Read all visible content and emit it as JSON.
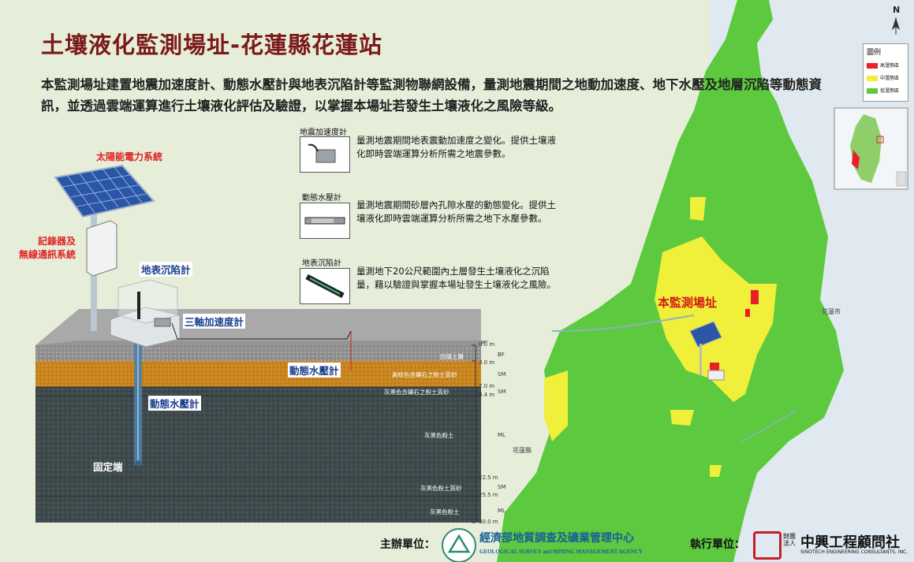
{
  "title": "土壤液化監測場址-花蓮縣花蓮站",
  "description": "本監測場址建置地震加速度計、動態水壓計與地表沉陷計等監測物聯網設備，量測地震期間之地動加速度、地下水壓及地層沉陷等動態資訊，並透過雲端運算進行土壤液化評估及驗證，以掌握本場址若發生土壤液化之風險等級。",
  "instruments": [
    {
      "label": "地震加速度計",
      "desc": "量測地震期間地表震動加速度之變化。提供土壤液化即時雲端運算分析所需之地震參數。",
      "icon": "accelerometer-icon"
    },
    {
      "label": "動態水壓計",
      "desc": "量測地震期間砂層內孔隙水壓的動態變化。提供土壤液化即時雲端運算分析所需之地下水壓參數。",
      "icon": "piezometer-icon"
    },
    {
      "label": "地表沉陷計",
      "desc": "量測地下20公尺範圍內土層發生土壤液化之沉陷量，藉以驗證與掌握本場址發生土壤液化之風險。",
      "icon": "settlement-gauge-icon"
    }
  ],
  "diagram_labels": {
    "solar": "太陽能電力系統",
    "recorder_line1": "記錄器及",
    "recorder_line2": "無線通訊系統",
    "settlement": "地表沉陷計",
    "accelerometer": "三軸加速度計",
    "piezometer_upper": "動態水壓計",
    "piezometer_lower": "動態水壓計",
    "anchor": "固定端"
  },
  "soil_layers": [
    {
      "name": "回填土層",
      "code": "BF",
      "top": "0.0 m",
      "color": "#8e8e8e"
    },
    {
      "name": "黃棕色含礫石之粉土質砂",
      "code": "SM",
      "top": "3.0 m",
      "color": "#c9851f"
    },
    {
      "name": "灰黑色含礫石之粉土質砂",
      "code": "SM",
      "top": "7.0 m",
      "color": "#3e4a4c"
    },
    {
      "name": "灰黑色粉土",
      "code": "ML",
      "top": "8.4 m",
      "color": "#3e4a4c"
    },
    {
      "name": "灰黑色粉土質砂",
      "code": "SM",
      "top": "22.5 m",
      "color": "#3e4a4c"
    },
    {
      "name": "灰黑色粉土",
      "code": "ML",
      "top": "25.5 m",
      "color": "#3e4a4c"
    }
  ],
  "bottom_depth": "30.0 m",
  "map": {
    "site_label": "本監測場址",
    "county_label": "花蓮縣",
    "town_label": "花蓮市",
    "north": "N",
    "colors": {
      "high": "#e8202a",
      "medium": "#f0ef3a",
      "low": "#5cc93f",
      "sea": "#dfe9ef"
    }
  },
  "legend": {
    "title": "圖例",
    "items": [
      {
        "label": "高潛勢區",
        "color": "#e8202a"
      },
      {
        "label": "中潛勢區",
        "color": "#f0ef3a"
      },
      {
        "label": "低潛勢區",
        "color": "#5cc93f"
      }
    ]
  },
  "footer": {
    "organizer_label": "主辦單位：",
    "organizer_name": "經濟部地質調查及礦業管理中心",
    "organizer_name_en": "GEOLOGICAL SURVEY and MINING MANAGEMENT AGENCY",
    "executor_label": "執行單位：",
    "executor_prefix_1": "財團",
    "executor_prefix_2": "法人",
    "executor_name": "中興工程顧問社",
    "executor_name_en": "SINOTECH ENGINEERING CONSULTANTS, INC."
  }
}
